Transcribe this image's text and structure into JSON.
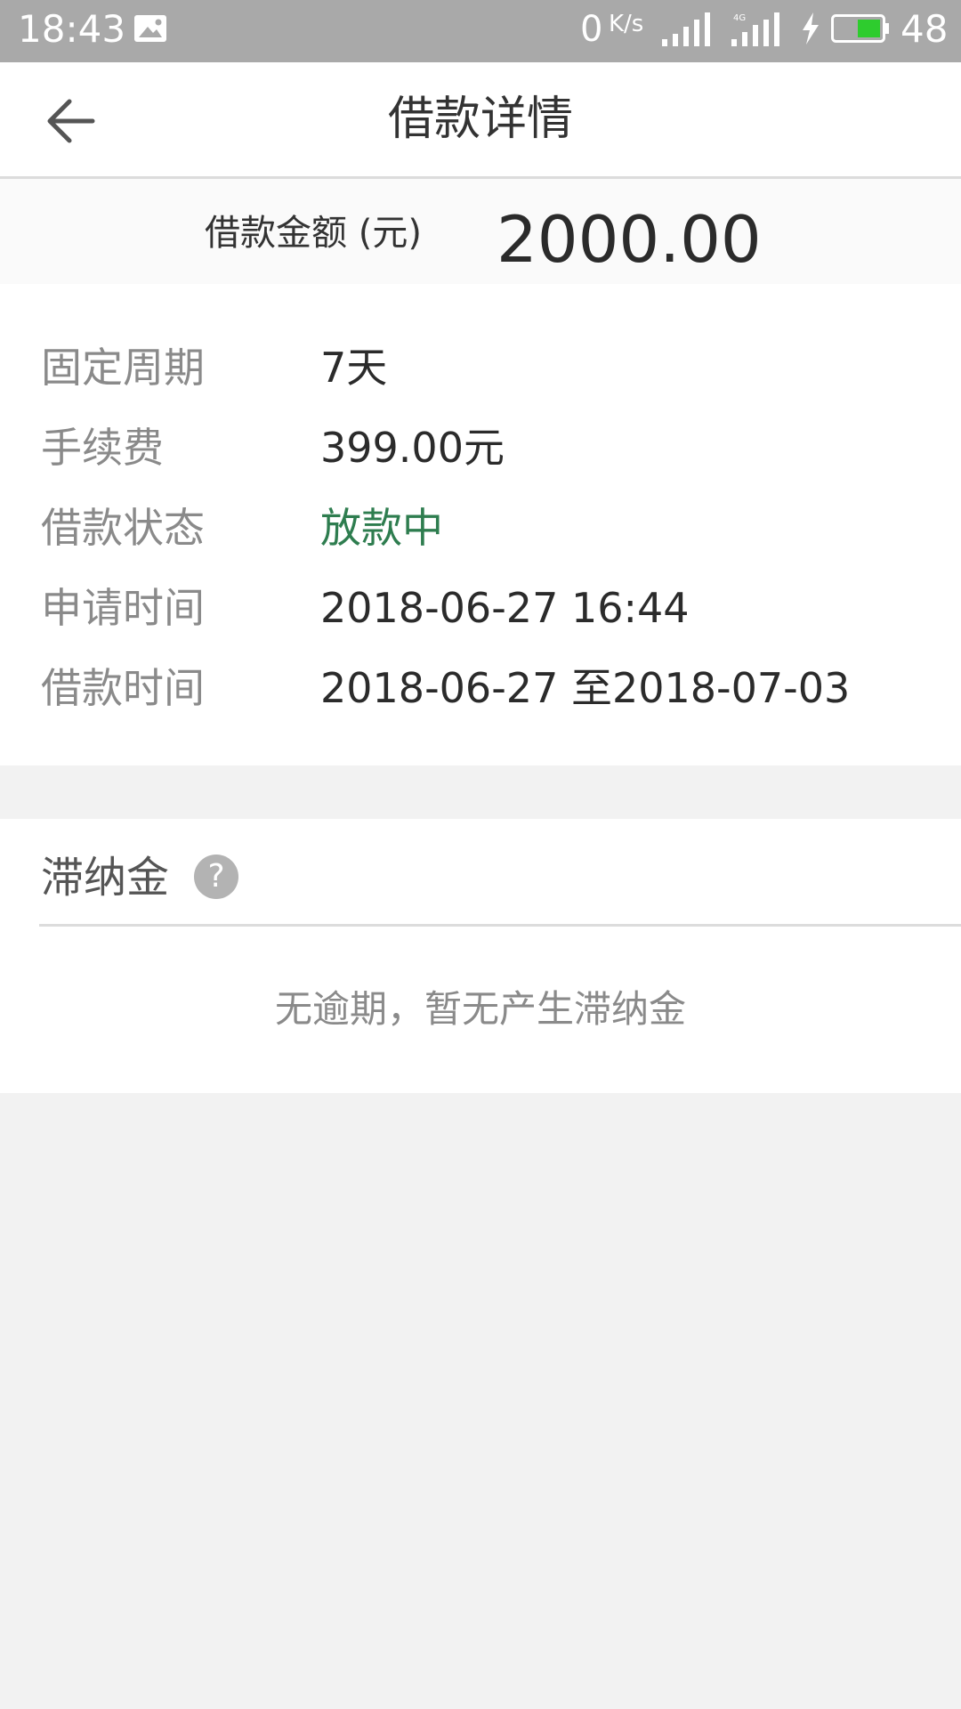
{
  "status_bar": {
    "time": "18:43",
    "net_speed": "0",
    "net_speed_unit": "K/s",
    "network_type": "4G",
    "battery_level": "48",
    "battery_color": "#2ecc2e"
  },
  "header": {
    "title": "借款详情",
    "back_icon": "arrow-left-icon"
  },
  "amount": {
    "label": "借款金额 (元)",
    "value": "2000.00"
  },
  "details": {
    "rows": [
      {
        "label": "固定周期",
        "value": "7天"
      },
      {
        "label": "手续费",
        "value": "399.00元"
      },
      {
        "label": "借款状态",
        "value": "放款中"
      },
      {
        "label": "申请时间",
        "value": "2018-06-27 16:44"
      },
      {
        "label": "借款时间",
        "value": "2018-06-27 至2018-07-03"
      }
    ],
    "status_color": "#2e7d4f"
  },
  "late_fee": {
    "title": "滞纳金",
    "help_symbol": "?",
    "empty_message": "无逾期，暂无产生滞纳金"
  }
}
